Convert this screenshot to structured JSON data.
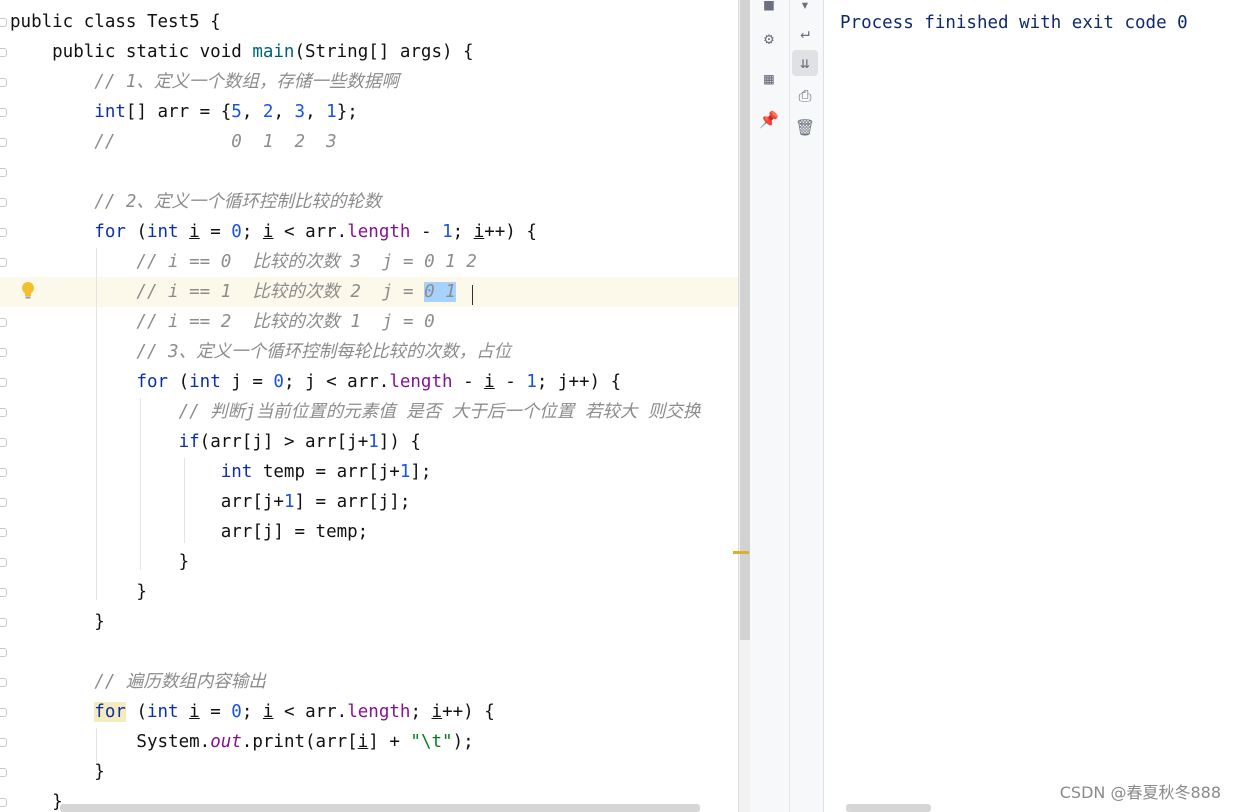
{
  "editor": {
    "lines": [
      {
        "tokens": [
          {
            "t": "public class Test5 {",
            "c": "plain"
          }
        ]
      },
      {
        "tokens": [
          {
            "t": "    public static void ",
            "c": "plain"
          },
          {
            "t": "main",
            "c": "mth"
          },
          {
            "t": "(String[] args) {",
            "c": "plain"
          }
        ]
      },
      {
        "tokens": [
          {
            "t": "        // 1、定义一个数组，存储一些数据啊",
            "c": "cm"
          }
        ]
      },
      {
        "tokens": [
          {
            "t": "        ",
            "c": "plain"
          },
          {
            "t": "int",
            "c": "kw"
          },
          {
            "t": "[] arr = {",
            "c": "plain"
          },
          {
            "t": "5",
            "c": "num"
          },
          {
            "t": ", ",
            "c": "plain"
          },
          {
            "t": "2",
            "c": "num"
          },
          {
            "t": ", ",
            "c": "plain"
          },
          {
            "t": "3",
            "c": "num"
          },
          {
            "t": ", ",
            "c": "plain"
          },
          {
            "t": "1",
            "c": "num"
          },
          {
            "t": "};",
            "c": "plain"
          }
        ]
      },
      {
        "tokens": [
          {
            "t": "        //           0  1  2  3",
            "c": "cm"
          }
        ]
      },
      {
        "tokens": []
      },
      {
        "tokens": [
          {
            "t": "        // 2、定义一个循环控制比较的轮数",
            "c": "cm"
          }
        ]
      },
      {
        "tokens": [
          {
            "t": "        ",
            "c": "plain"
          },
          {
            "t": "for",
            "c": "kw"
          },
          {
            "t": " (",
            "c": "plain"
          },
          {
            "t": "int",
            "c": "kw"
          },
          {
            "t": " ",
            "c": "plain"
          },
          {
            "t": "i",
            "c": "ul"
          },
          {
            "t": " = ",
            "c": "plain"
          },
          {
            "t": "0",
            "c": "num"
          },
          {
            "t": "; ",
            "c": "plain"
          },
          {
            "t": "i",
            "c": "ul"
          },
          {
            "t": " < arr.",
            "c": "plain"
          },
          {
            "t": "length",
            "c": "fld"
          },
          {
            "t": " - ",
            "c": "plain"
          },
          {
            "t": "1",
            "c": "num"
          },
          {
            "t": "; ",
            "c": "plain"
          },
          {
            "t": "i",
            "c": "ul"
          },
          {
            "t": "++) {",
            "c": "plain"
          }
        ]
      },
      {
        "tokens": [
          {
            "t": "            // i == 0  比较的次数 3  j = 0 1 2",
            "c": "cm"
          }
        ]
      },
      {
        "tokens": [
          {
            "t": "            // i == 1  比较的次数 2  j = ",
            "c": "cm"
          },
          {
            "t": "0 1",
            "c": "cm-sel"
          }
        ],
        "current": true
      },
      {
        "tokens": [
          {
            "t": "            // i == 2  比较的次数 1  j = 0",
            "c": "cm"
          }
        ]
      },
      {
        "tokens": [
          {
            "t": "            // 3、定义一个循环控制每轮比较的次数，占位",
            "c": "cm"
          }
        ]
      },
      {
        "tokens": [
          {
            "t": "            ",
            "c": "plain"
          },
          {
            "t": "for",
            "c": "kw"
          },
          {
            "t": " (",
            "c": "plain"
          },
          {
            "t": "int",
            "c": "kw"
          },
          {
            "t": " j = ",
            "c": "plain"
          },
          {
            "t": "0",
            "c": "num"
          },
          {
            "t": "; j < arr.",
            "c": "plain"
          },
          {
            "t": "length",
            "c": "fld"
          },
          {
            "t": " - ",
            "c": "plain"
          },
          {
            "t": "i",
            "c": "ul"
          },
          {
            "t": " - ",
            "c": "plain"
          },
          {
            "t": "1",
            "c": "num"
          },
          {
            "t": "; j++) {",
            "c": "plain"
          }
        ]
      },
      {
        "tokens": [
          {
            "t": "                // 判断j当前位置的元素值 是否 大于后一个位置 若较大 则交换",
            "c": "cm"
          }
        ]
      },
      {
        "tokens": [
          {
            "t": "                ",
            "c": "plain"
          },
          {
            "t": "if",
            "c": "kw"
          },
          {
            "t": "(arr[j] > arr[j+",
            "c": "plain"
          },
          {
            "t": "1",
            "c": "num"
          },
          {
            "t": "]) {",
            "c": "plain"
          }
        ]
      },
      {
        "tokens": [
          {
            "t": "                    ",
            "c": "plain"
          },
          {
            "t": "int",
            "c": "kw"
          },
          {
            "t": " temp = arr[j+",
            "c": "plain"
          },
          {
            "t": "1",
            "c": "num"
          },
          {
            "t": "];",
            "c": "plain"
          }
        ]
      },
      {
        "tokens": [
          {
            "t": "                    arr[j+",
            "c": "plain"
          },
          {
            "t": "1",
            "c": "num"
          },
          {
            "t": "] = arr[j];",
            "c": "plain"
          }
        ]
      },
      {
        "tokens": [
          {
            "t": "                    arr[j] = temp;",
            "c": "plain"
          }
        ]
      },
      {
        "tokens": [
          {
            "t": "                }",
            "c": "plain"
          }
        ]
      },
      {
        "tokens": [
          {
            "t": "            }",
            "c": "plain"
          }
        ]
      },
      {
        "tokens": [
          {
            "t": "        }",
            "c": "plain"
          }
        ]
      },
      {
        "tokens": []
      },
      {
        "tokens": [
          {
            "t": "        // 遍历数组内容输出",
            "c": "cm"
          }
        ]
      },
      {
        "tokens": [
          {
            "t": "        ",
            "c": "plain"
          },
          {
            "t": "for",
            "c": "kw-hl"
          },
          {
            "t": " (",
            "c": "plain"
          },
          {
            "t": "int",
            "c": "kw"
          },
          {
            "t": " ",
            "c": "plain"
          },
          {
            "t": "i",
            "c": "ul"
          },
          {
            "t": " = ",
            "c": "plain"
          },
          {
            "t": "0",
            "c": "num"
          },
          {
            "t": "; ",
            "c": "plain"
          },
          {
            "t": "i",
            "c": "ul"
          },
          {
            "t": " < arr.",
            "c": "plain"
          },
          {
            "t": "length",
            "c": "fld"
          },
          {
            "t": "; ",
            "c": "plain"
          },
          {
            "t": "i",
            "c": "ul"
          },
          {
            "t": "++) {",
            "c": "plain"
          }
        ]
      },
      {
        "tokens": [
          {
            "t": "            System.",
            "c": "plain"
          },
          {
            "t": "out",
            "c": "itl"
          },
          {
            "t": ".print(arr[",
            "c": "plain"
          },
          {
            "t": "i",
            "c": "ul"
          },
          {
            "t": "] + ",
            "c": "plain"
          },
          {
            "t": "\"\\t\"",
            "c": "str"
          },
          {
            "t": ");",
            "c": "plain"
          }
        ]
      },
      {
        "tokens": [
          {
            "t": "        }",
            "c": "plain"
          }
        ]
      },
      {
        "tokens": [
          {
            "t": "    }",
            "c": "plain"
          }
        ]
      }
    ]
  },
  "toolbar": {
    "left": [
      {
        "icon": "stop-icon",
        "glyph": "■"
      },
      {
        "icon": "debug-settings-icon",
        "glyph": "⚙"
      },
      {
        "icon": "layout-icon",
        "glyph": "▦"
      },
      {
        "icon": "pin-icon",
        "glyph": "📌"
      }
    ],
    "right": [
      {
        "icon": "scroll-down-icon",
        "glyph": "▾"
      },
      {
        "icon": "soft-wrap-icon",
        "glyph": "↵"
      },
      {
        "icon": "scroll-to-end-icon",
        "glyph": "⇊",
        "active": true
      },
      {
        "icon": "print-icon",
        "glyph": "⎙"
      },
      {
        "icon": "trash-icon",
        "glyph": "🗑"
      }
    ]
  },
  "console": {
    "output": "Process finished with exit code 0"
  },
  "watermark": "CSDN @春夏秋冬888"
}
